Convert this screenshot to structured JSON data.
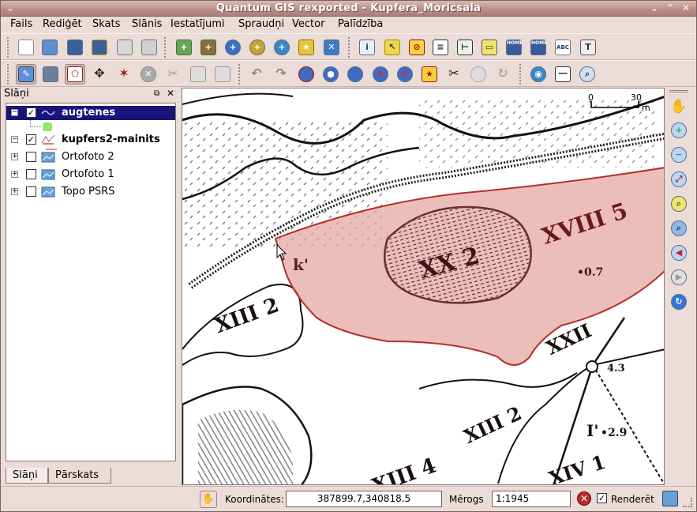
{
  "window": {
    "title": "Quantum GIS rexported - Kupfera_Moricsala",
    "controls": [
      "minimize",
      "maximize",
      "close"
    ]
  },
  "menu": [
    "Fails",
    "Rediģēt",
    "Skats",
    "Slānis",
    "Iestatījumi",
    "Spraudņi",
    "Vector",
    "Palīdzība"
  ],
  "toolbar1": {
    "icons": [
      "new-project-icon",
      "open-project-icon",
      "save-project-icon",
      "save-as-icon",
      "print-composer-icon",
      "print-icon",
      "add-raster-icon",
      "add-vector-icon",
      "add-postgis-icon",
      "add-spatialite-icon",
      "add-wms-icon",
      "new-vector-icon",
      "remove-layer-icon",
      "identify-icon",
      "select-icon",
      "deselect-icon",
      "attribute-table-icon",
      "measure-icon",
      "annotation-icon",
      "home-icon",
      "home-add-icon",
      "label-icon",
      "text-icon"
    ],
    "badges": {
      "home": "HOME",
      "abc": "ABC"
    }
  },
  "toolbar2": {
    "icons": [
      "toggle-edit-icon",
      "save-edits-icon",
      "capture-polygon-icon",
      "move-feature-icon",
      "node-tool-icon",
      "delete-icon",
      "cut-icon",
      "copy-icon",
      "paste-icon",
      "undo-icon",
      "redo-icon",
      "add-ring-icon",
      "add-island-icon",
      "fill-ring-icon",
      "delete-ring-icon",
      "delete-part-icon",
      "reshape-icon",
      "split-icon",
      "merge-icon",
      "rotate-icon",
      "refresh-icon",
      "gps-icon",
      "scalebar-icon",
      "magnifier-icon"
    ]
  },
  "layers_panel": {
    "title": "Slāņi",
    "layers": [
      {
        "name": "augtenes",
        "checked": true,
        "expanded": true,
        "selected": true,
        "kind": "polygon"
      },
      {
        "name": "kupfers2-mainits",
        "checked": true,
        "expanded": true,
        "selected": false,
        "kind": "line"
      },
      {
        "name": "Ortofoto 2",
        "checked": false,
        "expanded": false,
        "selected": false,
        "kind": "raster"
      },
      {
        "name": "Ortofoto 1",
        "checked": false,
        "expanded": false,
        "selected": false,
        "kind": "raster"
      },
      {
        "name": "Topo PSRS",
        "checked": false,
        "expanded": false,
        "selected": false,
        "kind": "raster"
      }
    ],
    "tabs": [
      "Slāņi",
      "Pārskats"
    ]
  },
  "map": {
    "scalebar": {
      "start": "0",
      "end": "30",
      "unit": "m"
    },
    "labels": [
      "XX 2",
      "XVIII 5",
      "XIII 2",
      "XIII 2",
      "XXII",
      "XIII 4",
      "XIV 1",
      "k'",
      "I'",
      "•0.7",
      "•2.9",
      "4.3"
    ],
    "polygon_fill": "#e5a8a3",
    "polygon_stroke": "#b3302c"
  },
  "map_tools": [
    "pan-icon",
    "zoom-in-icon",
    "zoom-out-icon",
    "zoom-full-icon",
    "zoom-selection-icon",
    "zoom-layer-icon",
    "zoom-last-icon",
    "zoom-next-icon",
    "refresh-map-icon"
  ],
  "status": {
    "coords_label": "Koordinātes:",
    "coords_value": "387899.7,340818.5",
    "scale_label": "Mērogs",
    "scale_value": "1:1945",
    "render_label": "Renderēt",
    "render_checked": true
  }
}
